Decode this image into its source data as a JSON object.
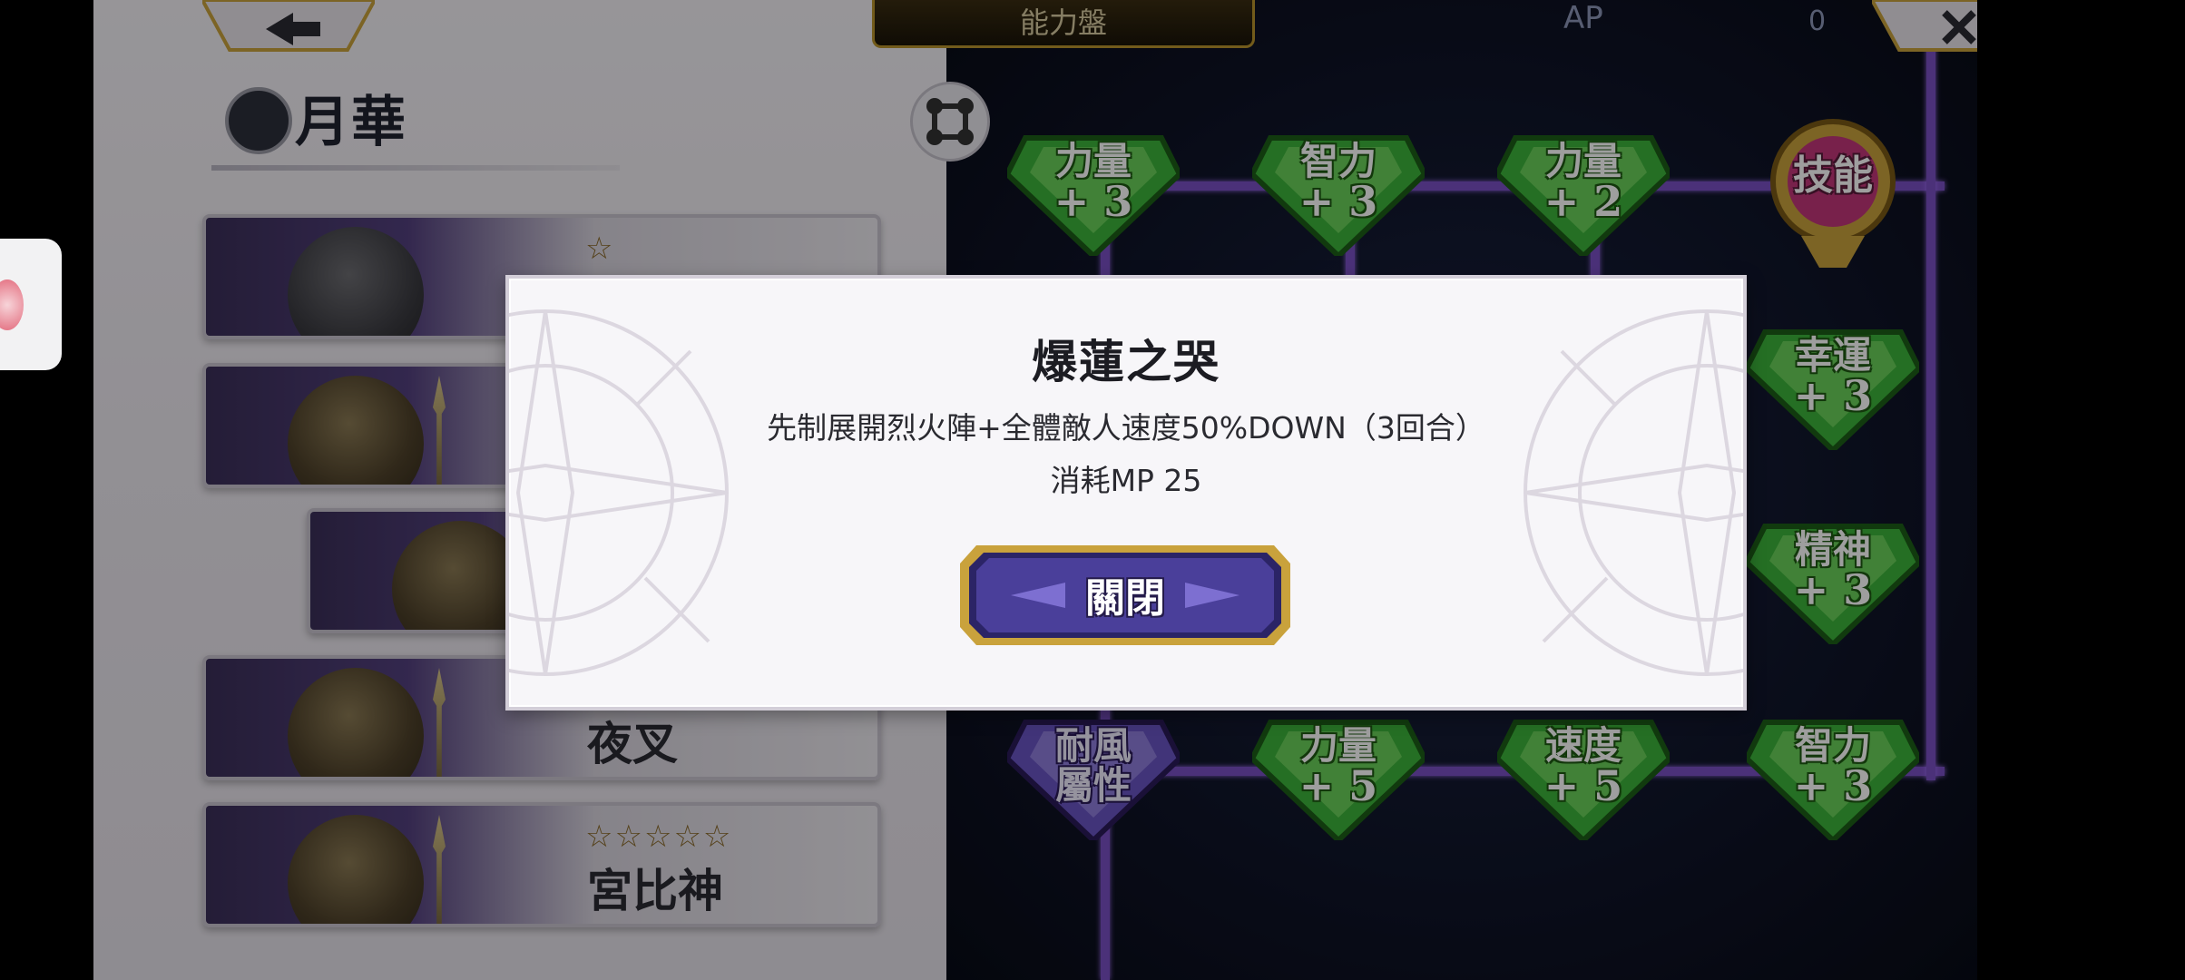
{
  "top_bar": {
    "title": "能力盤",
    "ap_label": "AP",
    "ap_value": "0"
  },
  "character": {
    "name": "月華"
  },
  "party_list": [
    {
      "name": "",
      "stars": "☆"
    },
    {
      "name": "",
      "stars": ""
    },
    {
      "name": "",
      "stars": ""
    },
    {
      "name": "夜叉",
      "stars": ""
    },
    {
      "name": "宮比神",
      "stars": "☆☆☆☆☆"
    }
  ],
  "ability_nodes": [
    {
      "line1": "力量",
      "line2": "+ 3",
      "type": "stat"
    },
    {
      "line1": "智力",
      "line2": "+ 3",
      "type": "stat"
    },
    {
      "line1": "力量",
      "line2": "+ 2",
      "type": "stat"
    },
    {
      "line1": "技能",
      "line2": "",
      "type": "skill"
    },
    {
      "line1": "幸運",
      "line2": "+ 3",
      "type": "stat"
    },
    {
      "line1": "精神",
      "line2": "+ 3",
      "type": "stat"
    },
    {
      "line1": "耐風",
      "line2": "屬性",
      "type": "element"
    },
    {
      "line1": "力量",
      "line2": "+ 5",
      "type": "stat"
    },
    {
      "line1": "速度",
      "line2": "+ 5",
      "type": "stat"
    },
    {
      "line1": "智力",
      "line2": "+ 3",
      "type": "stat"
    }
  ],
  "dialog": {
    "title": "爆蓮之哭",
    "description": "先制展開烈火陣+全體敵人速度50%DOWN（3回合）",
    "cost": "消耗MP 25",
    "close_label": "關閉"
  },
  "icons": {
    "back": "back-arrow-icon",
    "close": "close-x-icon",
    "formation": "formation-icon",
    "side_widget": "floating-app-icon"
  },
  "colors": {
    "node_green": "#3db33a",
    "node_purple": "#6a55c4",
    "tree_line": "#7a4fc4",
    "gold": "#c9a23c",
    "dialog_bg": "#f7f6f9",
    "button_purple": "#3b2f86"
  }
}
